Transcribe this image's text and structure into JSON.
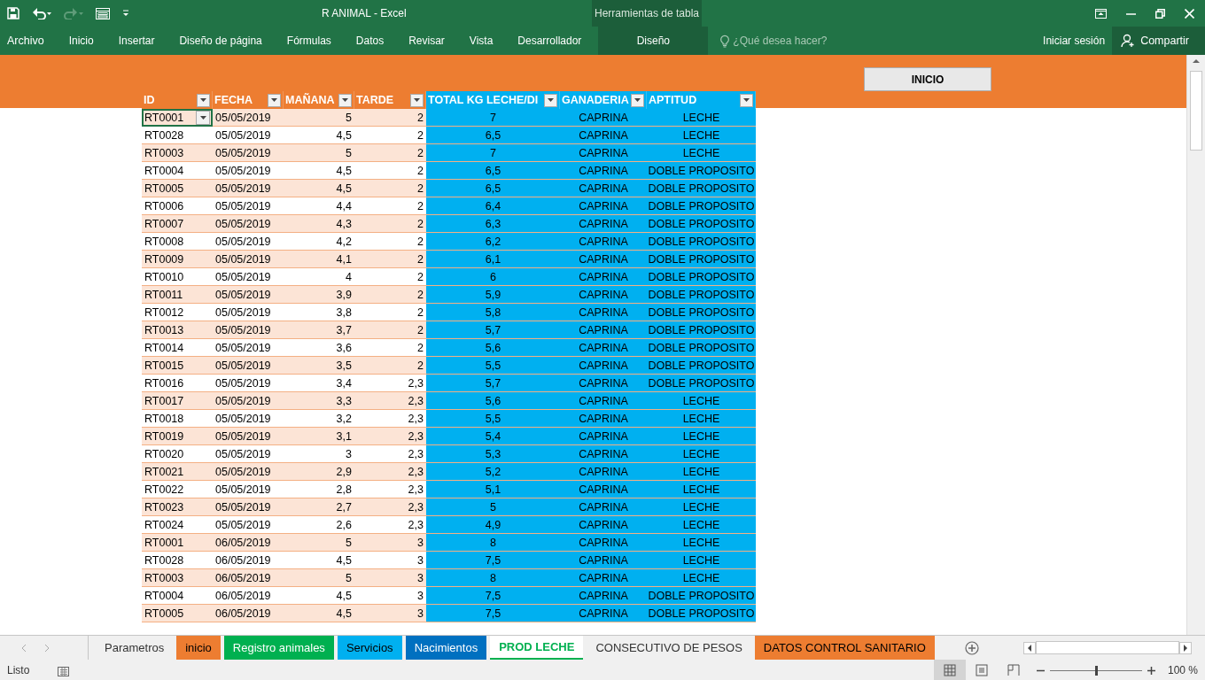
{
  "window": {
    "title": "R ANIMAL - Excel"
  },
  "ribbon": {
    "tabs": [
      {
        "label": "Archivo",
        "selected": false
      },
      {
        "label": "Inicio",
        "selected": false
      },
      {
        "label": "Insertar",
        "selected": false
      },
      {
        "label": "Diseño de página",
        "selected": false
      },
      {
        "label": "Fórmulas",
        "selected": false
      },
      {
        "label": "Datos",
        "selected": false
      },
      {
        "label": "Revisar",
        "selected": false
      },
      {
        "label": "Vista",
        "selected": false
      },
      {
        "label": "Desarrollador",
        "selected": false
      }
    ],
    "contextual": {
      "title": "Herramientas de tabla",
      "tab": "Diseño"
    },
    "tell_me": {
      "placeholder": "¿Qué desea hacer?"
    },
    "sign_in": "Iniciar sesión",
    "share": "Compartir"
  },
  "sheet": {
    "button": "INICIO",
    "columns": [
      {
        "label": "ID",
        "kind": "orange"
      },
      {
        "label": "FECHA",
        "kind": "orange"
      },
      {
        "label": "MAÑANA",
        "kind": "orange"
      },
      {
        "label": "TARDE",
        "kind": "orange"
      },
      {
        "label": "TOTAL KG LECHE/DI",
        "kind": "blue"
      },
      {
        "label": "GANADERIA",
        "kind": "blue"
      },
      {
        "label": "APTITUD",
        "kind": "blue"
      }
    ],
    "rows": [
      {
        "cells": [
          "RT0001",
          "05/05/2019",
          "5",
          "2",
          "7",
          "CAPRINA",
          "LECHE"
        ],
        "selected": true
      },
      {
        "cells": [
          "RT0028",
          "05/05/2019",
          "4,5",
          "2",
          "6,5",
          "CAPRINA",
          "LECHE"
        ],
        "selected": false
      },
      {
        "cells": [
          "RT0003",
          "05/05/2019",
          "5",
          "2",
          "7",
          "CAPRINA",
          "LECHE"
        ],
        "selected": false
      },
      {
        "cells": [
          "RT0004",
          "05/05/2019",
          "4,5",
          "2",
          "6,5",
          "CAPRINA",
          "DOBLE PROPOSITO"
        ],
        "selected": false
      },
      {
        "cells": [
          "RT0005",
          "05/05/2019",
          "4,5",
          "2",
          "6,5",
          "CAPRINA",
          "DOBLE PROPOSITO"
        ],
        "selected": false
      },
      {
        "cells": [
          "RT0006",
          "05/05/2019",
          "4,4",
          "2",
          "6,4",
          "CAPRINA",
          "DOBLE PROPOSITO"
        ],
        "selected": false
      },
      {
        "cells": [
          "RT0007",
          "05/05/2019",
          "4,3",
          "2",
          "6,3",
          "CAPRINA",
          "DOBLE PROPOSITO"
        ],
        "selected": false
      },
      {
        "cells": [
          "RT0008",
          "05/05/2019",
          "4,2",
          "2",
          "6,2",
          "CAPRINA",
          "DOBLE PROPOSITO"
        ],
        "selected": false
      },
      {
        "cells": [
          "RT0009",
          "05/05/2019",
          "4,1",
          "2",
          "6,1",
          "CAPRINA",
          "DOBLE PROPOSITO"
        ],
        "selected": false
      },
      {
        "cells": [
          "RT0010",
          "05/05/2019",
          "4",
          "2",
          "6",
          "CAPRINA",
          "DOBLE PROPOSITO"
        ],
        "selected": false
      },
      {
        "cells": [
          "RT0011",
          "05/05/2019",
          "3,9",
          "2",
          "5,9",
          "CAPRINA",
          "DOBLE PROPOSITO"
        ],
        "selected": false
      },
      {
        "cells": [
          "RT0012",
          "05/05/2019",
          "3,8",
          "2",
          "5,8",
          "CAPRINA",
          "DOBLE PROPOSITO"
        ],
        "selected": false
      },
      {
        "cells": [
          "RT0013",
          "05/05/2019",
          "3,7",
          "2",
          "5,7",
          "CAPRINA",
          "DOBLE PROPOSITO"
        ],
        "selected": false
      },
      {
        "cells": [
          "RT0014",
          "05/05/2019",
          "3,6",
          "2",
          "5,6",
          "CAPRINA",
          "DOBLE PROPOSITO"
        ],
        "selected": false
      },
      {
        "cells": [
          "RT0015",
          "05/05/2019",
          "3,5",
          "2",
          "5,5",
          "CAPRINA",
          "DOBLE PROPOSITO"
        ],
        "selected": false
      },
      {
        "cells": [
          "RT0016",
          "05/05/2019",
          "3,4",
          "2,3",
          "5,7",
          "CAPRINA",
          "DOBLE PROPOSITO"
        ],
        "selected": false
      },
      {
        "cells": [
          "RT0017",
          "05/05/2019",
          "3,3",
          "2,3",
          "5,6",
          "CAPRINA",
          "LECHE"
        ],
        "selected": false
      },
      {
        "cells": [
          "RT0018",
          "05/05/2019",
          "3,2",
          "2,3",
          "5,5",
          "CAPRINA",
          "LECHE"
        ],
        "selected": false
      },
      {
        "cells": [
          "RT0019",
          "05/05/2019",
          "3,1",
          "2,3",
          "5,4",
          "CAPRINA",
          "LECHE"
        ],
        "selected": false
      },
      {
        "cells": [
          "RT0020",
          "05/05/2019",
          "3",
          "2,3",
          "5,3",
          "CAPRINA",
          "LECHE"
        ],
        "selected": false
      },
      {
        "cells": [
          "RT0021",
          "05/05/2019",
          "2,9",
          "2,3",
          "5,2",
          "CAPRINA",
          "LECHE"
        ],
        "selected": false
      },
      {
        "cells": [
          "RT0022",
          "05/05/2019",
          "2,8",
          "2,3",
          "5,1",
          "CAPRINA",
          "LECHE"
        ],
        "selected": false
      },
      {
        "cells": [
          "RT0023",
          "05/05/2019",
          "2,7",
          "2,3",
          "5",
          "CAPRINA",
          "LECHE"
        ],
        "selected": false
      },
      {
        "cells": [
          "RT0024",
          "05/05/2019",
          "2,6",
          "2,3",
          "4,9",
          "CAPRINA",
          "LECHE"
        ],
        "selected": false
      },
      {
        "cells": [
          "RT0001",
          "06/05/2019",
          "5",
          "3",
          "8",
          "CAPRINA",
          "LECHE"
        ],
        "selected": false
      },
      {
        "cells": [
          "RT0028",
          "06/05/2019",
          "4,5",
          "3",
          "7,5",
          "CAPRINA",
          "LECHE"
        ],
        "selected": false
      },
      {
        "cells": [
          "RT0003",
          "06/05/2019",
          "5",
          "3",
          "8",
          "CAPRINA",
          "LECHE"
        ],
        "selected": false
      },
      {
        "cells": [
          "RT0004",
          "06/05/2019",
          "4,5",
          "3",
          "7,5",
          "CAPRINA",
          "DOBLE PROPOSITO"
        ],
        "selected": false
      },
      {
        "cells": [
          "RT0005",
          "06/05/2019",
          "4,5",
          "3",
          "7,5",
          "CAPRINA",
          "DOBLE PROPOSITO"
        ],
        "selected": false
      }
    ]
  },
  "sheet_tabs": [
    {
      "label": "Parametros",
      "selected": false
    },
    {
      "label": "inicio",
      "selected": false,
      "color": "#ed7d31"
    },
    {
      "label": "Registro animales",
      "selected": false,
      "color": "#00b050"
    },
    {
      "label": "Servicios",
      "selected": false,
      "color": "#00b0f0"
    },
    {
      "label": "Nacimientos",
      "selected": false,
      "color": "#0070c0"
    },
    {
      "label": "PROD LECHE",
      "selected": true,
      "color": "#00b050"
    },
    {
      "label": "CONSECUTIVO DE PESOS",
      "selected": false
    },
    {
      "label": "DATOS CONTROL SANITARIO",
      "selected": false,
      "color": "#ed7d31"
    }
  ],
  "status_bar": {
    "status": "Listo",
    "views": [
      {
        "kind": "normal",
        "selected": true
      },
      {
        "kind": "page",
        "selected": false
      },
      {
        "kind": "break",
        "selected": false
      }
    ],
    "zoom": {
      "level": 0.5,
      "reading": "100 %"
    }
  }
}
